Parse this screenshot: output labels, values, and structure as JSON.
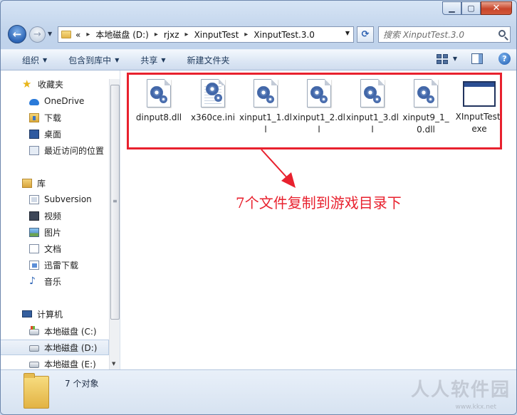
{
  "window": {
    "caption_min": "▁",
    "caption_max": "▢",
    "caption_close": "✕"
  },
  "address": {
    "prefix": "«",
    "crumbs": [
      "本地磁盘 (D:)",
      "rjxz",
      "XinputTest",
      "XinputTest.3.0"
    ]
  },
  "search": {
    "placeholder": "搜索 XinputTest.3.0"
  },
  "toolbar": {
    "organize": "组织",
    "include_library": "包含到库中",
    "share": "共享",
    "new_folder": "新建文件夹",
    "help": "?"
  },
  "sidebar": {
    "favorites": "收藏夹",
    "onedrive": "OneDrive",
    "downloads": "下载",
    "desktop": "桌面",
    "recent": "最近访问的位置",
    "libraries": "库",
    "subversion": "Subversion",
    "videos": "视频",
    "pictures": "图片",
    "documents": "文档",
    "thunder": "迅雷下载",
    "music": "音乐",
    "computer": "计算机",
    "disk_c": "本地磁盘 (C:)",
    "disk_d": "本地磁盘 (D:)",
    "disk_e": "本地磁盘 (E:)"
  },
  "files": [
    {
      "name": "dinput8.dll",
      "icon": "dll-gear-icon"
    },
    {
      "name": "x360ce.ini",
      "icon": "ini-config-icon"
    },
    {
      "name": "xinput1_1.dll",
      "icon": "dll-gear-icon"
    },
    {
      "name": "xinput1_2.dll",
      "icon": "dll-gear-icon"
    },
    {
      "name": "xinput1_3.dll",
      "icon": "dll-gear-icon"
    },
    {
      "name": "xinput9_1_0.dll",
      "icon": "dll-gear-icon"
    },
    {
      "name": "XInputTest.exe",
      "icon": "exe-window-icon"
    }
  ],
  "annotation": "7个文件复制到游戏目录下",
  "details": {
    "count": "7 个对象"
  },
  "watermark": "人人软件园",
  "watermark_url": "www.kkx.net",
  "colors": {
    "highlight": "#e8212e",
    "accent": "#2c64b5"
  }
}
